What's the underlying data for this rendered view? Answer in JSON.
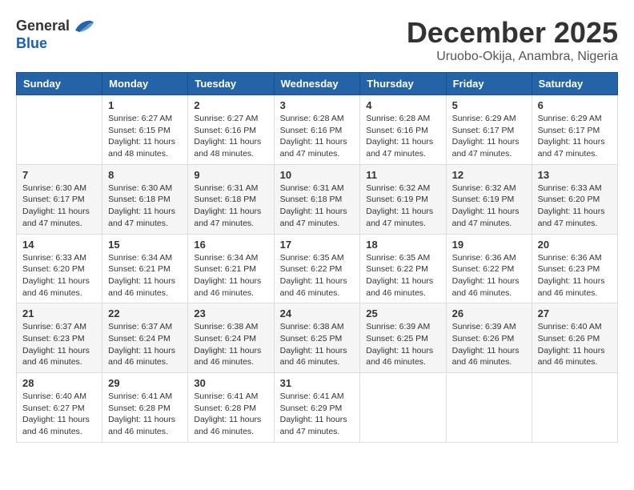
{
  "logo": {
    "general": "General",
    "blue": "Blue"
  },
  "title": "December 2025",
  "location": "Uruobo-Okija, Anambra, Nigeria",
  "weekdays": [
    "Sunday",
    "Monday",
    "Tuesday",
    "Wednesday",
    "Thursday",
    "Friday",
    "Saturday"
  ],
  "weeks": [
    [
      {
        "day": "",
        "info": ""
      },
      {
        "day": "1",
        "info": "Sunrise: 6:27 AM\nSunset: 6:15 PM\nDaylight: 11 hours\nand 48 minutes."
      },
      {
        "day": "2",
        "info": "Sunrise: 6:27 AM\nSunset: 6:16 PM\nDaylight: 11 hours\nand 48 minutes."
      },
      {
        "day": "3",
        "info": "Sunrise: 6:28 AM\nSunset: 6:16 PM\nDaylight: 11 hours\nand 47 minutes."
      },
      {
        "day": "4",
        "info": "Sunrise: 6:28 AM\nSunset: 6:16 PM\nDaylight: 11 hours\nand 47 minutes."
      },
      {
        "day": "5",
        "info": "Sunrise: 6:29 AM\nSunset: 6:17 PM\nDaylight: 11 hours\nand 47 minutes."
      },
      {
        "day": "6",
        "info": "Sunrise: 6:29 AM\nSunset: 6:17 PM\nDaylight: 11 hours\nand 47 minutes."
      }
    ],
    [
      {
        "day": "7",
        "info": "Sunrise: 6:30 AM\nSunset: 6:17 PM\nDaylight: 11 hours\nand 47 minutes."
      },
      {
        "day": "8",
        "info": "Sunrise: 6:30 AM\nSunset: 6:18 PM\nDaylight: 11 hours\nand 47 minutes."
      },
      {
        "day": "9",
        "info": "Sunrise: 6:31 AM\nSunset: 6:18 PM\nDaylight: 11 hours\nand 47 minutes."
      },
      {
        "day": "10",
        "info": "Sunrise: 6:31 AM\nSunset: 6:18 PM\nDaylight: 11 hours\nand 47 minutes."
      },
      {
        "day": "11",
        "info": "Sunrise: 6:32 AM\nSunset: 6:19 PM\nDaylight: 11 hours\nand 47 minutes."
      },
      {
        "day": "12",
        "info": "Sunrise: 6:32 AM\nSunset: 6:19 PM\nDaylight: 11 hours\nand 47 minutes."
      },
      {
        "day": "13",
        "info": "Sunrise: 6:33 AM\nSunset: 6:20 PM\nDaylight: 11 hours\nand 47 minutes."
      }
    ],
    [
      {
        "day": "14",
        "info": "Sunrise: 6:33 AM\nSunset: 6:20 PM\nDaylight: 11 hours\nand 46 minutes."
      },
      {
        "day": "15",
        "info": "Sunrise: 6:34 AM\nSunset: 6:21 PM\nDaylight: 11 hours\nand 46 minutes."
      },
      {
        "day": "16",
        "info": "Sunrise: 6:34 AM\nSunset: 6:21 PM\nDaylight: 11 hours\nand 46 minutes."
      },
      {
        "day": "17",
        "info": "Sunrise: 6:35 AM\nSunset: 6:22 PM\nDaylight: 11 hours\nand 46 minutes."
      },
      {
        "day": "18",
        "info": "Sunrise: 6:35 AM\nSunset: 6:22 PM\nDaylight: 11 hours\nand 46 minutes."
      },
      {
        "day": "19",
        "info": "Sunrise: 6:36 AM\nSunset: 6:22 PM\nDaylight: 11 hours\nand 46 minutes."
      },
      {
        "day": "20",
        "info": "Sunrise: 6:36 AM\nSunset: 6:23 PM\nDaylight: 11 hours\nand 46 minutes."
      }
    ],
    [
      {
        "day": "21",
        "info": "Sunrise: 6:37 AM\nSunset: 6:23 PM\nDaylight: 11 hours\nand 46 minutes."
      },
      {
        "day": "22",
        "info": "Sunrise: 6:37 AM\nSunset: 6:24 PM\nDaylight: 11 hours\nand 46 minutes."
      },
      {
        "day": "23",
        "info": "Sunrise: 6:38 AM\nSunset: 6:24 PM\nDaylight: 11 hours\nand 46 minutes."
      },
      {
        "day": "24",
        "info": "Sunrise: 6:38 AM\nSunset: 6:25 PM\nDaylight: 11 hours\nand 46 minutes."
      },
      {
        "day": "25",
        "info": "Sunrise: 6:39 AM\nSunset: 6:25 PM\nDaylight: 11 hours\nand 46 minutes."
      },
      {
        "day": "26",
        "info": "Sunrise: 6:39 AM\nSunset: 6:26 PM\nDaylight: 11 hours\nand 46 minutes."
      },
      {
        "day": "27",
        "info": "Sunrise: 6:40 AM\nSunset: 6:26 PM\nDaylight: 11 hours\nand 46 minutes."
      }
    ],
    [
      {
        "day": "28",
        "info": "Sunrise: 6:40 AM\nSunset: 6:27 PM\nDaylight: 11 hours\nand 46 minutes."
      },
      {
        "day": "29",
        "info": "Sunrise: 6:41 AM\nSunset: 6:28 PM\nDaylight: 11 hours\nand 46 minutes."
      },
      {
        "day": "30",
        "info": "Sunrise: 6:41 AM\nSunset: 6:28 PM\nDaylight: 11 hours\nand 46 minutes."
      },
      {
        "day": "31",
        "info": "Sunrise: 6:41 AM\nSunset: 6:29 PM\nDaylight: 11 hours\nand 47 minutes."
      },
      {
        "day": "",
        "info": ""
      },
      {
        "day": "",
        "info": ""
      },
      {
        "day": "",
        "info": ""
      }
    ]
  ]
}
